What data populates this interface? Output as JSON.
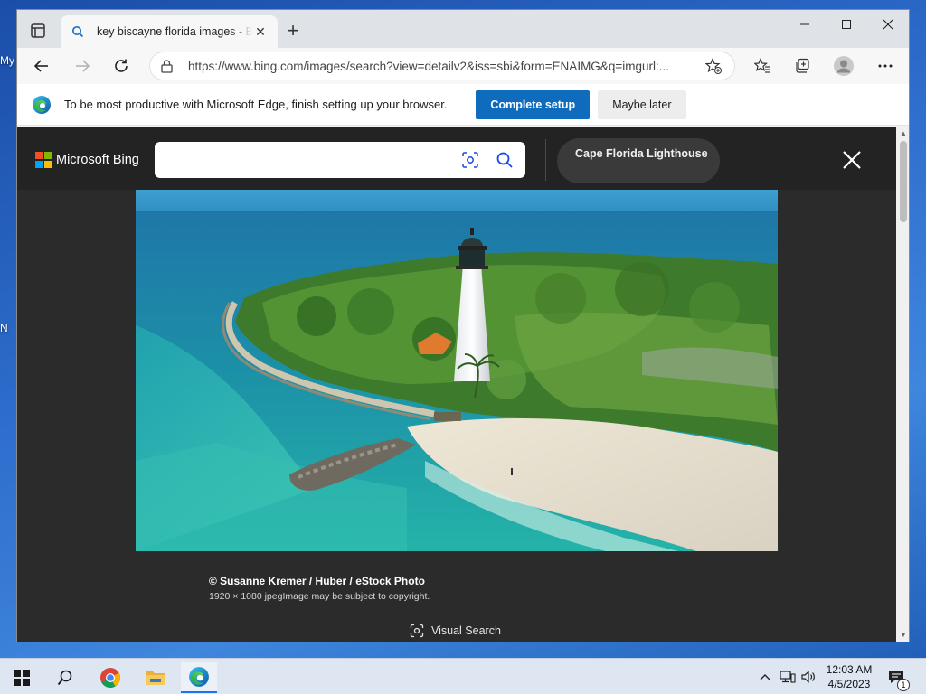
{
  "desktop": {
    "fragments": [
      "My",
      "N"
    ]
  },
  "browser": {
    "tab": {
      "title": "key biscayne florida images - Bing"
    },
    "address": {
      "url": "https://www.bing.com/images/search?view=detailv2&iss=sbi&form=ENAIMG&q=imgurl:..."
    },
    "infobar": {
      "message": "To be most productive with Microsoft Edge, finish setting up your browser.",
      "primary_label": "Complete setup",
      "secondary_label": "Maybe later"
    }
  },
  "bing": {
    "brand": "Microsoft Bing",
    "search_value": "",
    "related_pill": "Cape Florida Lighthouse",
    "image": {
      "credit": "© Susanne Kremer / Huber / eStock Photo",
      "meta": "1920 × 1080 jpegImage may be subject to copyright."
    },
    "visual_search_label": "Visual Search"
  },
  "taskbar": {
    "time": "12:03 AM",
    "date": "4/5/2023",
    "notification_count": "1"
  },
  "colors": {
    "edge_blue": "#0f6cbd",
    "viewer_bg": "#2b2b2b",
    "header_bg": "#232323",
    "ms_red": "#f25022",
    "ms_green": "#7fba00",
    "ms_blue": "#00a4ef",
    "ms_yellow": "#ffb900"
  }
}
